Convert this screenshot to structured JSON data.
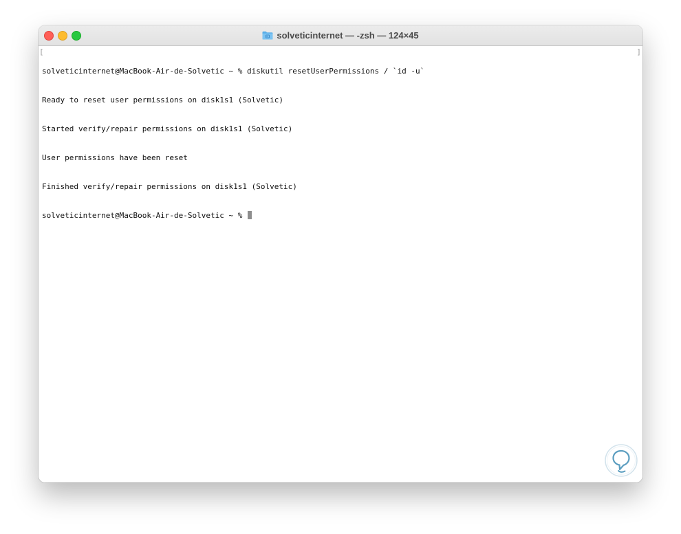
{
  "window": {
    "title": "solveticinternet — -zsh — 124×45"
  },
  "colors": {
    "close": "#ff5f57",
    "minimize": "#febc2e",
    "maximize": "#28c840",
    "folder_icon": "#5aaee8",
    "cursor": "#8e8e8e"
  },
  "terminal": {
    "lines": [
      "solveticinternet@MacBook-Air-de-Solvetic ~ % diskutil resetUserPermissions / `id -u`",
      "Ready to reset user permissions on disk1s1 (Solvetic)",
      "Started verify/repair permissions on disk1s1 (Solvetic)",
      "User permissions have been reset",
      "Finished verify/repair permissions on disk1s1 (Solvetic)"
    ],
    "prompt": "solveticinternet@MacBook-Air-de-Solvetic ~ % ",
    "left_bracket": "[",
    "right_bracket": "]"
  },
  "icons": {
    "title_icon": "folder-icon",
    "watermark": "solvetic-logo"
  }
}
